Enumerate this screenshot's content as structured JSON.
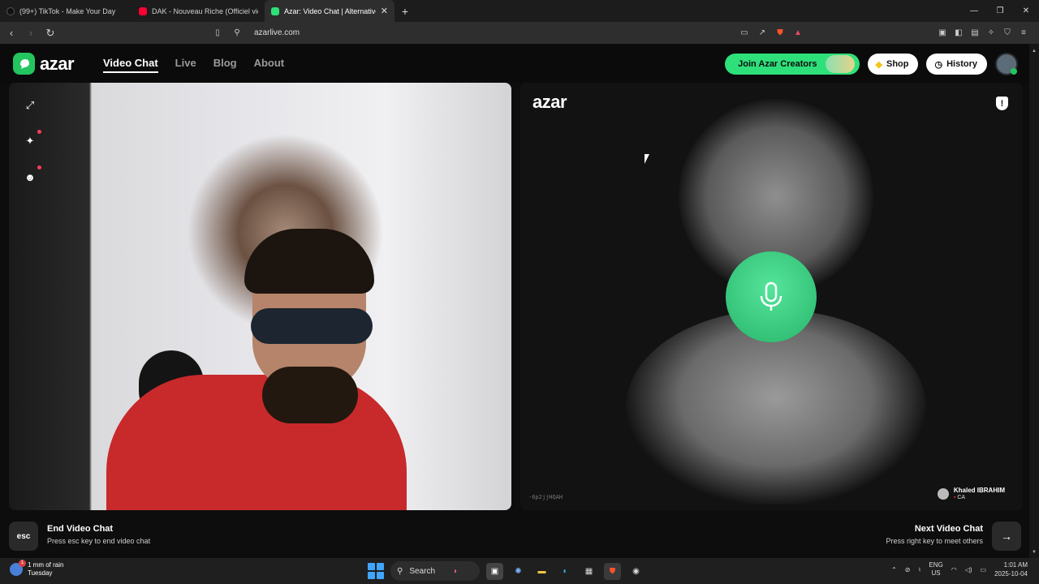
{
  "browser": {
    "tabs": [
      {
        "title": "(99+) TikTok - Make Your Day",
        "favicon_color": "#111111",
        "active": false
      },
      {
        "title": "DAK - Nouveau Riche (Officiel vidéo",
        "favicon_color": "#ff0033",
        "active": false
      },
      {
        "title": "Azar: Video Chat | Alternative",
        "favicon_color": "#2ee07a",
        "active": true
      }
    ],
    "new_tab": "+",
    "url": "azarlive.com"
  },
  "site": {
    "logo_text": "azar",
    "nav": [
      {
        "label": "Video Chat",
        "active": true
      },
      {
        "label": "Live",
        "active": false
      },
      {
        "label": "Blog",
        "active": false
      },
      {
        "label": "About",
        "active": false
      }
    ],
    "buttons": {
      "creators": "Join Azar Creators",
      "shop": "Shop",
      "history": "History"
    },
    "accent": "#2ee07a"
  },
  "right_panel": {
    "logo_text": "azar",
    "shield_label": "!",
    "session_id": "-6p2jjHQAH",
    "peer": {
      "name": "Khaled IBRAHIM",
      "country": "CA"
    }
  },
  "footer": {
    "esc_key": "esc",
    "end_title": "End Video Chat",
    "end_sub": "Press esc key to end video chat",
    "next_title": "Next Video Chat",
    "next_sub": "Press right key to meet others",
    "next_key": "→"
  },
  "taskbar": {
    "weather_line1": "1 mm of rain",
    "weather_line2": "Tuesday",
    "weather_badge": "1",
    "search_label": "Search",
    "lang_line1": "ENG",
    "lang_line2": "US",
    "time": "1:01 AM",
    "date": "2025-10-04"
  }
}
